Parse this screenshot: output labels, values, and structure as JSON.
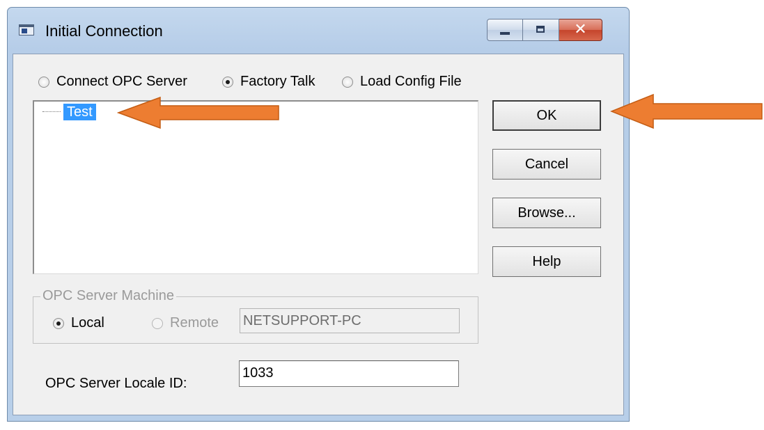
{
  "window": {
    "title": "Initial Connection",
    "title_icon": "app-window-icon",
    "controls": {
      "minimize": "minimize-icon",
      "maximize": "maximize-icon",
      "close_glyph": "✕"
    }
  },
  "source_options": [
    {
      "label": "Connect OPC Server",
      "checked": false
    },
    {
      "label": "Factory Talk",
      "checked": true
    },
    {
      "label": "Load Config File",
      "checked": false
    }
  ],
  "tree": {
    "items": [
      {
        "label": "Test",
        "selected": true
      }
    ]
  },
  "buttons": {
    "ok": "OK",
    "cancel": "Cancel",
    "browse": "Browse...",
    "help": "Help"
  },
  "server_machine": {
    "legend": "OPC Server Machine",
    "local_label": "Local",
    "local_checked": true,
    "remote_label": "Remote",
    "remote_checked": false,
    "machine_name": "NETSUPPORT-PC"
  },
  "locale": {
    "label": "OPC Server Locale ID:",
    "value": "1033"
  },
  "annotations": {
    "arrow_color": "#ed7d31"
  },
  "colors": {
    "selection": "#3399ff",
    "titlebar": "#b9d1ea",
    "close_button": "#c74a32"
  }
}
